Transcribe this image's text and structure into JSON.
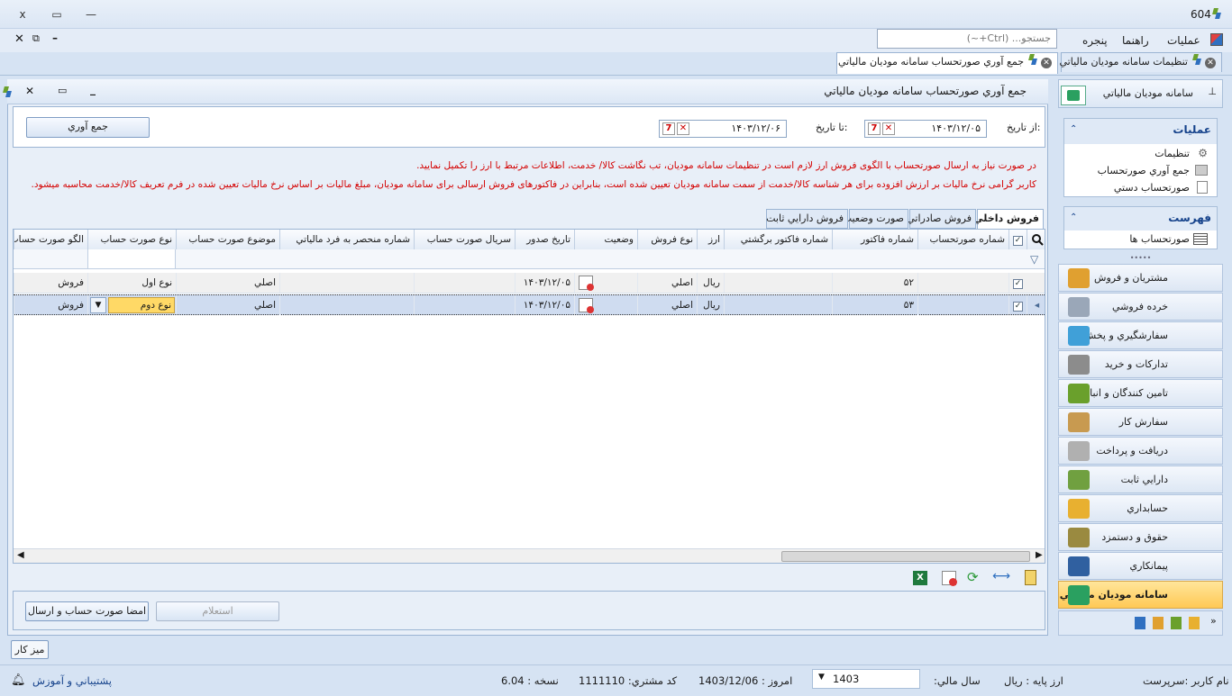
{
  "window": {
    "title": "604",
    "close": "x",
    "restore": "▭",
    "minimize": "—"
  },
  "menu": {
    "items": [
      "عمليات",
      "راهنما",
      "پنجره"
    ],
    "search_placeholder": "جستجو... (Ctrl+~)"
  },
  "doc_tabs": [
    {
      "label": "تنظيمات سامانه موديان مالياتي"
    },
    {
      "label": "جمع آوري صورتحساب سامانه موديان مالياتي"
    }
  ],
  "panel": {
    "title": "جمع آوري صورتحساب سامانه موديان مالياتي",
    "from_label": "از تاريخ:",
    "from_value": "۱۴۰۳/۱۲/۰۵",
    "to_label": "تا تاريخ:",
    "to_value": "۱۴۰۳/۱۲/۰۶",
    "collect_button": "جمع آوري",
    "msg1": "در صورت نياز به ارسال صورتحساب با الگوی فروش ارز لازم است در تنظيمات سامانه موديان، تب نگاشت کالا/ خدمت، اطلاعات مرتبط با ارز را تکميل نماييد.",
    "msg2": "کاربر گرامی نرخ ماليات بر ارزش افزوده برای هر شناسه کالا/خدمت از سمت سامانه موديان تعيين شده است، بنابراين در فاکتورهای فروش ارسالی برای سامانه موديان، مبلغ ماليات بر اساس نرخ ماليات تعيين شده در فرم تعريف کالا/خدمت محاسبه ميشود.",
    "grid_tabs": [
      "فروش داخلي",
      "فروش صادراتي",
      "صورت وضعيت",
      "فروش دارايي ثابت"
    ],
    "columns": [
      "شماره صورتحساب",
      "شماره فاکتور",
      "شماره فاکتور برگشتي",
      "ارز",
      "نوع فروش",
      "وضعيت",
      "تاريخ صدور",
      "سريال صورت حساب",
      "شماره منحصر به فرد مالياتي",
      "موضوع صورت حساب",
      "نوع صورت حساب",
      "الگو صورت حساب"
    ],
    "rows": [
      {
        "invoice_no": "۵۲",
        "currency": "ريال",
        "sale_type": "اصلي",
        "date": "۱۴۰۳/۱۲/۰۵",
        "subject": "اصلي",
        "type": "نوع اول",
        "pattern": "فروش"
      },
      {
        "invoice_no": "۵۳",
        "currency": "ريال",
        "sale_type": "اصلي",
        "date": "۱۴۰۳/۱۲/۰۵",
        "subject": "اصلي",
        "type": "نوع دوم",
        "pattern": "فروش"
      }
    ],
    "inquiry_button": "استعلام",
    "sign_button": "امضا صورت حساب و ارسال"
  },
  "sidebar": {
    "header": "سامانه موديان مالياتي",
    "ops_title": "عمليات",
    "ops_items": [
      "تنظيمات",
      "جمع آوري صورتحساب",
      "صورتحساب دستي"
    ],
    "list_title": "فهرست",
    "list_items": [
      "صورتحساب ها"
    ],
    "nav": [
      {
        "label": "مشتريان و فروش",
        "color": "#e0a030"
      },
      {
        "label": "خرده فروشي",
        "color": "#9aa7b8"
      },
      {
        "label": "سفارشگيري و پخش",
        "color": "#40a0d8"
      },
      {
        "label": "تداركات و خريد",
        "color": "#8c8c8c"
      },
      {
        "label": "تامين كنندگان و انبار",
        "color": "#6aa02c"
      },
      {
        "label": "سفارش كار",
        "color": "#c89a50"
      },
      {
        "label": "دريافت و پرداخت",
        "color": "#b0b0b0"
      },
      {
        "label": "دارايي ثابت",
        "color": "#70a040"
      },
      {
        "label": "حسابداري",
        "color": "#e8b030"
      },
      {
        "label": "حقوق و دستمزد",
        "color": "#9a8a40"
      },
      {
        "label": "پيمانكاري",
        "color": "#3060a0"
      },
      {
        "label": "سامانه موديان مالياتي",
        "color": "#2aa060"
      }
    ]
  },
  "desk_tab": "ميز كار",
  "status": {
    "user": "نام کاربر :سرپرست",
    "base_currency": "ارز پايه :  ريال",
    "fiscal_label": "سال مالي:",
    "fiscal_value": "1403",
    "today": "امروز :   1403/12/06",
    "customer": "کد مشتري:   1111110",
    "version": "نسخه :   6.04",
    "support": "پشتيباني و آموزش"
  },
  "colors": {
    "accent": "#15428b",
    "warning": "#d40000",
    "active_nav": "#ffc955",
    "selected_row": "#cfdcf0"
  }
}
